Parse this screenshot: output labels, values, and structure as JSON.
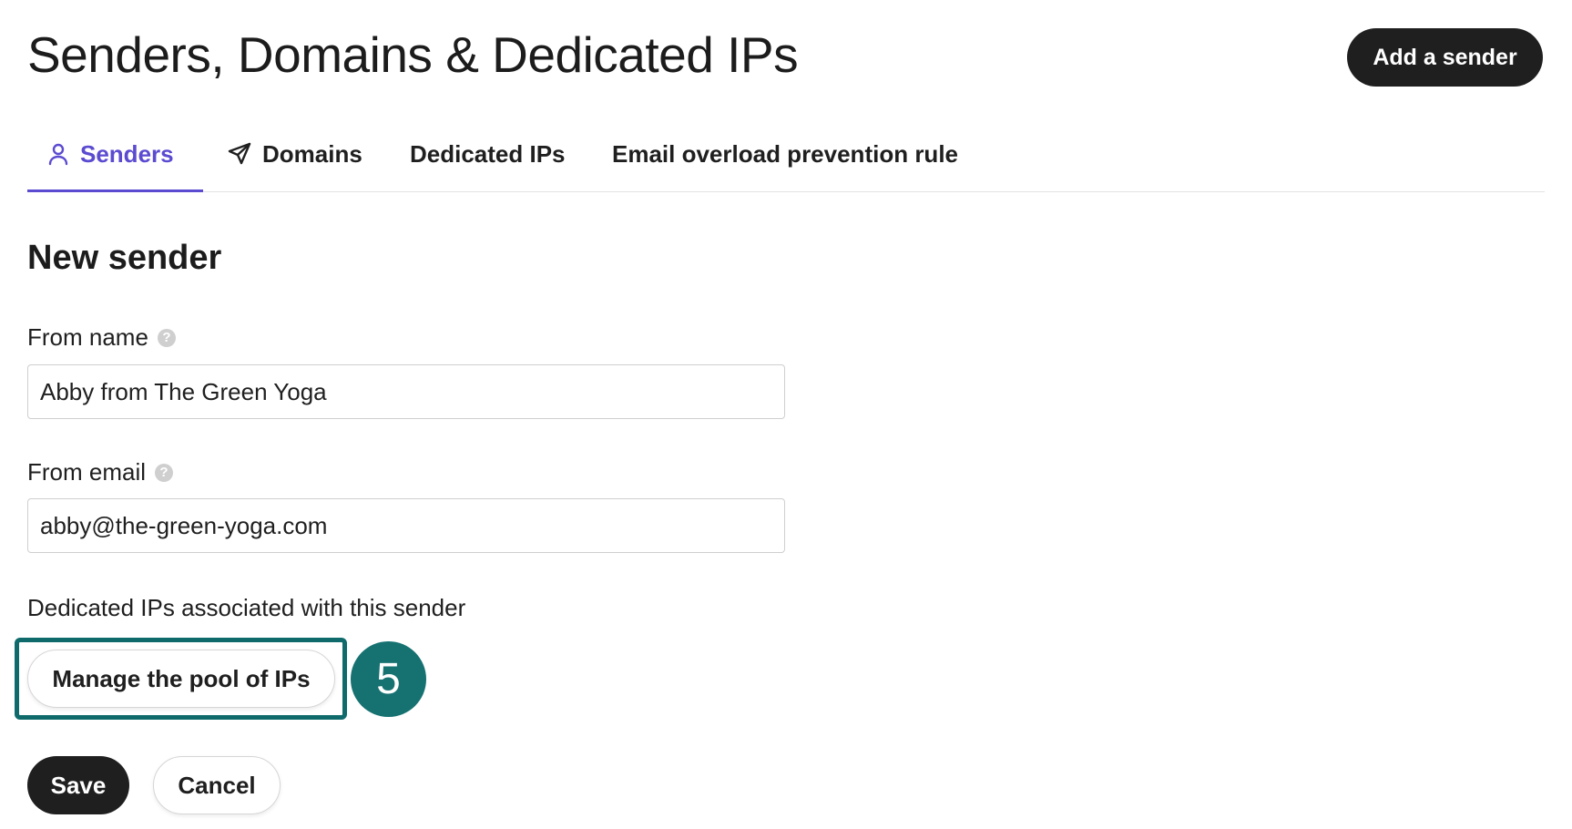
{
  "header": {
    "title": "Senders, Domains & Dedicated IPs",
    "add_sender_label": "Add a sender"
  },
  "tabs": [
    {
      "label": "Senders",
      "icon": "user-icon",
      "active": true
    },
    {
      "label": "Domains",
      "icon": "send-icon",
      "active": false
    },
    {
      "label": "Dedicated IPs",
      "active": false
    },
    {
      "label": "Email overload prevention rule",
      "active": false
    }
  ],
  "form": {
    "title": "New sender",
    "from_name": {
      "label": "From name",
      "value": "Abby from The Green Yoga"
    },
    "from_email": {
      "label": "From email",
      "value": "abby@the-green-yoga.com"
    },
    "ips": {
      "label": "Dedicated IPs associated with this sender",
      "manage_label": "Manage the pool of IPs"
    },
    "save_label": "Save",
    "cancel_label": "Cancel"
  },
  "annotation": {
    "step": "5",
    "color": "#167171"
  },
  "colors": {
    "accent": "#5b4bd1",
    "primary_button": "#1f1f1f"
  }
}
